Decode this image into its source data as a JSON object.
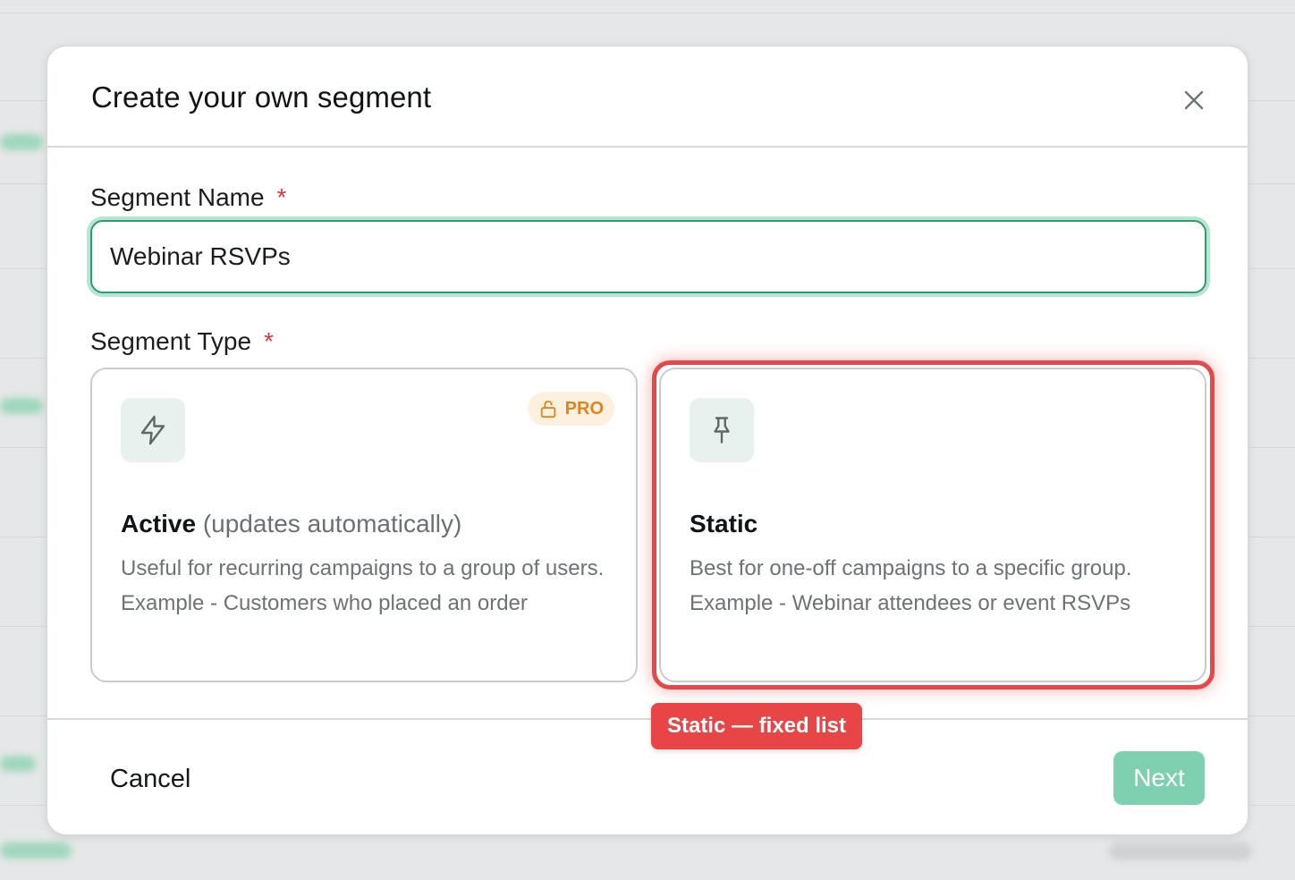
{
  "modal": {
    "title": "Create your own segment"
  },
  "segment_name": {
    "label": "Segment Name",
    "required_mark": "*",
    "value": "Webinar RSVPs"
  },
  "segment_type": {
    "label": "Segment Type",
    "required_mark": "*",
    "options": [
      {
        "title": "Active",
        "subtitle": "(updates automatically)",
        "description": "Useful for recurring campaigns to a group of users. Example - Customers who placed an order",
        "icon": "lightning-icon",
        "badge": "PRO"
      },
      {
        "title": "Static",
        "description": "Best for one-off campaigns to a specific group. Example - Webinar attendees or event RSVPs",
        "icon": "pin-icon"
      }
    ]
  },
  "annotation": {
    "label": "Static — fixed list",
    "color": "#e84646"
  },
  "footer": {
    "cancel_label": "Cancel",
    "next_label": "Next"
  },
  "colors": {
    "accent": "#2f9b6f",
    "next_button": "#7fd0b0",
    "pro_badge": "#e0851e",
    "required": "#d63b3b"
  }
}
